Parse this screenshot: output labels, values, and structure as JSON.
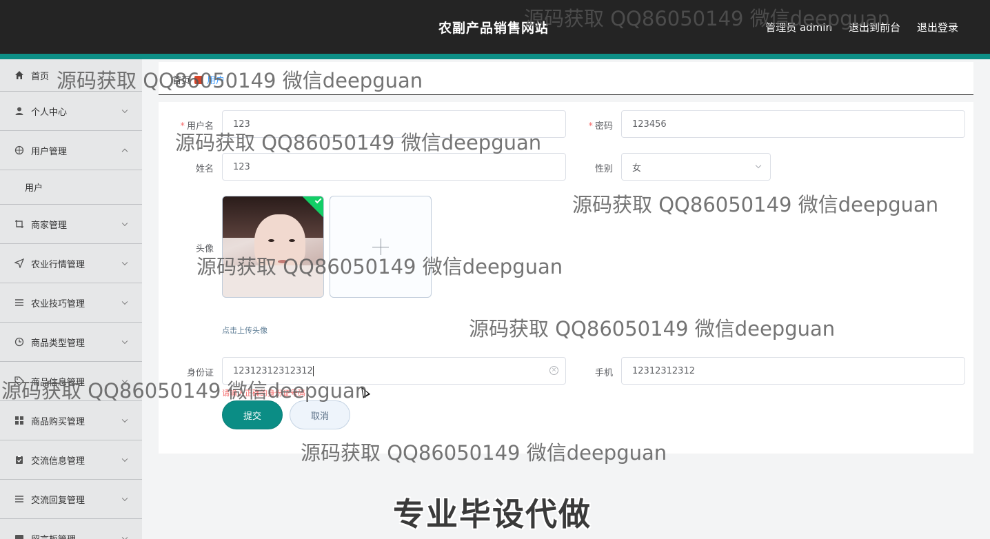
{
  "header": {
    "title": "农副产品销售网站",
    "links": [
      "管理员 admin",
      "退出到前台",
      "退出登录"
    ]
  },
  "sidebar": {
    "items": [
      {
        "label": "首页",
        "icon": "home-icon",
        "arrow": "none"
      },
      {
        "label": "个人中心",
        "icon": "user-icon",
        "arrow": "down"
      },
      {
        "label": "用户管理",
        "icon": "globe-icon",
        "arrow": "up"
      },
      {
        "label": "用户",
        "icon": "",
        "arrow": "none",
        "sub": true
      },
      {
        "label": "商家管理",
        "icon": "crop-icon",
        "arrow": "down"
      },
      {
        "label": "农业行情管理",
        "icon": "send-icon",
        "arrow": "down"
      },
      {
        "label": "农业技巧管理",
        "icon": "list-icon",
        "arrow": "down"
      },
      {
        "label": "商品类型管理",
        "icon": "clock-icon",
        "arrow": "down"
      },
      {
        "label": "商品信息管理",
        "icon": "tag-icon",
        "arrow": "down"
      },
      {
        "label": "商品购买管理",
        "icon": "grid-icon",
        "arrow": "down"
      },
      {
        "label": "交流信息管理",
        "icon": "clipboard-icon",
        "arrow": "down"
      },
      {
        "label": "交流回复管理",
        "icon": "menu-icon",
        "arrow": "down"
      },
      {
        "label": "留言板管理",
        "icon": "chat-icon",
        "arrow": "down"
      }
    ]
  },
  "breadcrumb": {
    "home": "首页",
    "current": "用户"
  },
  "form": {
    "username_label": "用户名",
    "username_value": "123",
    "password_label": "密码",
    "password_value": "123456",
    "name_label": "姓名",
    "name_value": "123",
    "gender_label": "性别",
    "gender_value": "女",
    "avatar_label": "头像",
    "upload_tip": "点击上传头像",
    "idcard_label": "身份证",
    "idcard_value": "12312312312312",
    "idcard_error": "请输入正确的身份证号码",
    "phone_label": "手机",
    "phone_value": "12312312312",
    "submit_label": "提交",
    "cancel_label": "取消"
  },
  "watermarks": {
    "text": "源码获取 QQ86050149 微信deepguan",
    "promo": "专业毕设代做"
  },
  "colors": {
    "header_bg": "#242424",
    "accent": "#0d8f86",
    "sidebar_bg": "#e6e7e8",
    "required": "#f56c6c"
  }
}
